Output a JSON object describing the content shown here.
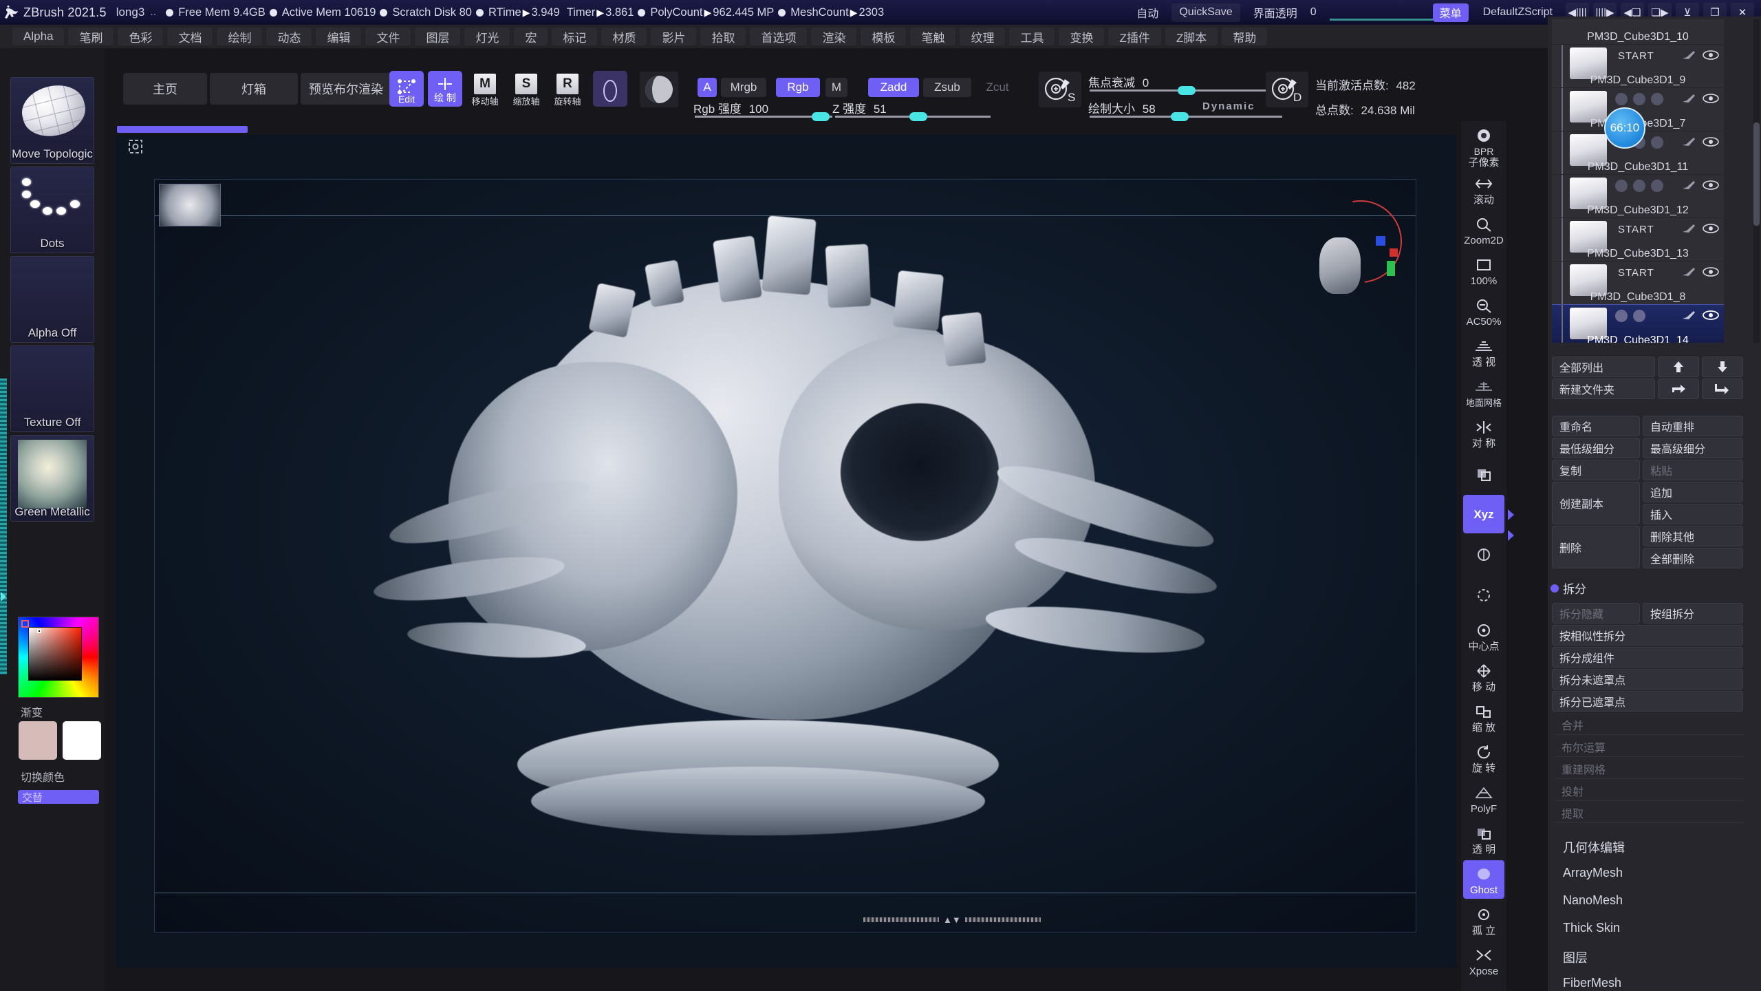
{
  "titlebar": {
    "app_title": "ZBrush 2021.5",
    "document": "long3",
    "ellipsis": "..",
    "stats": [
      {
        "label": "Free Mem",
        "value": "9.4GB",
        "arrow": false
      },
      {
        "label": "Active Mem",
        "value": "10619",
        "arrow": false
      },
      {
        "label": "Scratch Disk",
        "value": "80",
        "arrow": false
      },
      {
        "label": "RTime",
        "value": "3.949",
        "arrow": true
      },
      {
        "label": "Timer",
        "value": "3.861",
        "arrow": true,
        "nobullet": true
      },
      {
        "label": "PolyCount",
        "value": "962.445 MP",
        "arrow": true
      },
      {
        "label": "MeshCount",
        "value": "2303",
        "arrow": true
      }
    ],
    "auto_label": "自动",
    "quicksave_label": "QuickSave",
    "ui_transparency_label": "界面透明",
    "ui_transparency_value": "0",
    "menu_toggle_label": "菜单",
    "zscript_label": "DefaultZScript",
    "nav_left_icon": "chevron-left-bars-icon",
    "nav_right_icon": "chevron-right-bars-icon",
    "window_left_icon": "window-prev-icon",
    "window_right_icon": "window-next-icon",
    "minimize_icon": "minimize-icon",
    "maximize_icon": "restore-icon",
    "close_icon": "close-icon"
  },
  "menubar": {
    "items": [
      "Alpha",
      "笔刷",
      "色彩",
      "文档",
      "绘制",
      "动态",
      "编辑",
      "文件",
      "图层",
      "灯光",
      "宏",
      "标记",
      "材质",
      "影片",
      "拾取",
      "首选项",
      "渲染",
      "模板",
      "笔触",
      "纹理",
      "工具",
      "变换",
      "Z插件",
      "Z脚本",
      "帮助"
    ]
  },
  "toolbar": {
    "tabs": [
      {
        "label": "主页"
      },
      {
        "label": "灯箱"
      },
      {
        "label": "预览布尔渲染"
      }
    ],
    "edit_label": "Edit",
    "draw_label": "绘 制",
    "move_axis_label": "移动轴",
    "scale_axis_label": "缩放轴",
    "rotate_axis_label": "旋转轴",
    "move_axis_key": "M",
    "scale_axis_key": "S",
    "rotate_axis_key": "R",
    "mrgb_a": "A",
    "mrgb": "Mrgb",
    "rgb": "Rgb",
    "m": "M",
    "zadd": "Zadd",
    "zsub": "Zsub",
    "zcut": "Zcut",
    "rgb_intensity_label": "Rgb 强度",
    "rgb_intensity_value": "100",
    "z_intensity_label": "Z 强度",
    "z_intensity_value": "51",
    "focal_shift_label": "焦点衰减",
    "focal_shift_value": "0",
    "draw_size_label": "绘制大小",
    "draw_size_value": "58",
    "dynamic_label": "Dynamic",
    "active_points_label": "当前激活点数:",
    "active_points_value": "482",
    "total_points_label": "总点数:",
    "total_points_value": "24.638 Mil"
  },
  "left_shelf": {
    "brush": {
      "label": "Move Topologic",
      "icon": "brush-preview-icon"
    },
    "stroke": {
      "label": "Dots",
      "icon": "stroke-dots-icon"
    },
    "alpha": {
      "label": "Alpha Off",
      "icon": "alpha-off-icon"
    },
    "texture": {
      "label": "Texture Off",
      "icon": "texture-off-icon"
    },
    "material": {
      "label": "Green Metallic",
      "icon": "material-sphere-icon"
    },
    "gradient_label": "渐变",
    "switch_color_label": "切换颜色",
    "alt_label": "交替",
    "primary_color": "#d5bcb8",
    "secondary_color": "#ffffff"
  },
  "canvas": {
    "thumbnail_icon": "canvas-thumbnail-icon",
    "head_icon": "head-bust-icon",
    "gizmo_icon": "rotation-gizmo-icon",
    "persp_icon": "perspective-frame-icon",
    "scrub_left_icon": "scrub-left-icon",
    "scrub_right_icon": "scrub-right-icon"
  },
  "rail": {
    "items": [
      {
        "label": "子像素",
        "top_label": "BPR",
        "icon": "bpr-render-icon"
      },
      {
        "label": "滚动",
        "icon": "scroll-icon"
      },
      {
        "label": "Zoom2D",
        "icon": "zoom2d-icon"
      },
      {
        "label": "100%",
        "icon": "actual-size-icon"
      },
      {
        "label": "AC50%",
        "icon": "half-size-icon"
      },
      {
        "label": "透 视",
        "icon": "perspective-icon"
      },
      {
        "label": "地面网格",
        "icon": "floor-grid-icon"
      },
      {
        "label": "对 称",
        "icon": "symmetry-icon"
      },
      {
        "label": "",
        "icon": "transp-icon"
      },
      {
        "label": "Xyz",
        "icon": "xyz-icon"
      },
      {
        "label": "",
        "icon": "local-icon"
      },
      {
        "label": "",
        "icon": "frame-icon"
      },
      {
        "label": "中心点",
        "icon": "center-point-icon"
      },
      {
        "label": "移 动",
        "icon": "move-icon"
      },
      {
        "label": "缩 放",
        "icon": "scale-icon"
      },
      {
        "label": "旋 转",
        "icon": "rotate-icon"
      },
      {
        "label": "PolyF",
        "icon": "polyframe-icon"
      },
      {
        "label": "透 明",
        "icon": "transparent-icon"
      },
      {
        "label": "Ghost",
        "icon": "ghost-icon"
      },
      {
        "label": "孤 立",
        "icon": "solo-icon"
      },
      {
        "label": "Xpose",
        "icon": "xpose-icon"
      }
    ]
  },
  "subtool": {
    "rows": [
      {
        "name": "PM3D_Cube3D1_10",
        "start": "",
        "selected": false,
        "partial": true
      },
      {
        "name": "PM3D_Cube3D1_9",
        "start": "START",
        "selected": false
      },
      {
        "name": "PM3D_Cube3D1_7",
        "start": "",
        "selected": false
      },
      {
        "name": "PM3D_Cube3D1_11",
        "start": "",
        "selected": false
      },
      {
        "name": "PM3D_Cube3D1_12",
        "start": "",
        "selected": false
      },
      {
        "name": "PM3D_Cube3D1_13",
        "start": "START",
        "selected": false
      },
      {
        "name": "PM3D_Cube3D1_8",
        "start": "START",
        "selected": false
      },
      {
        "name": "PM3D_Cube3D1_14",
        "start": "",
        "selected": true
      }
    ],
    "timer_badge": "66:10",
    "list_all_label": "全部列出",
    "new_folder_label": "新建文件夹",
    "up_icon": "arrow-up-icon",
    "down_icon": "arrow-down-icon",
    "move-in-icon": "arrow-turn-right-icon",
    "move-out-icon": "arrow-turn-down-icon"
  },
  "panel_buttons": {
    "rename": "重命名",
    "auto_reorder": "自动重排",
    "lowest_subdiv": "最低级细分",
    "highest_subdiv": "最高级细分",
    "copy": "复制",
    "paste": "粘贴",
    "duplicate": "创建副本",
    "append": "追加",
    "insert": "插入",
    "delete": "删除",
    "delete_other": "删除其他",
    "delete_all": "全部删除"
  },
  "split_section": {
    "title": "拆分",
    "hidden": "拆分隐藏",
    "by_group": "按组拆分",
    "by_similarity": "按相似性拆分",
    "to_parts": "拆分成组件",
    "unmasked": "拆分未遮罩点",
    "masked": "拆分已遮罩点"
  },
  "flat_sections": [
    "合并",
    "布尔运算",
    "重建网格",
    "投射",
    "提取"
  ],
  "bottom_sections": [
    "几何体编辑",
    "ArrayMesh",
    "NanoMesh",
    "Thick Skin",
    "图层",
    "FiberMesh"
  ]
}
